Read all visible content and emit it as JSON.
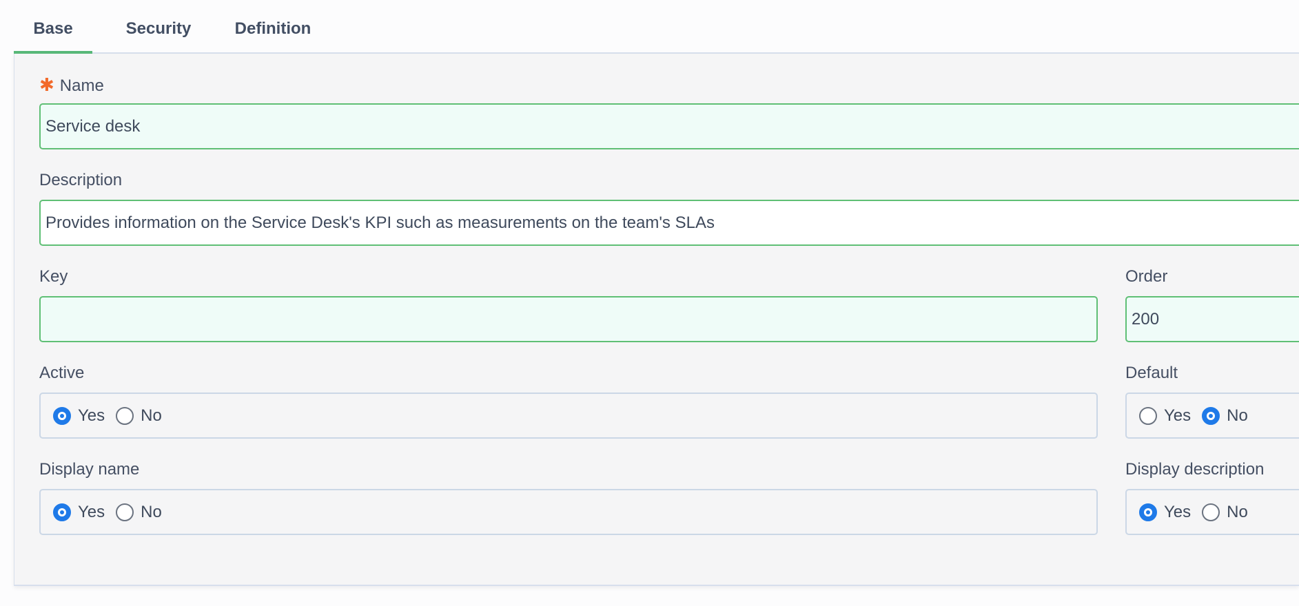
{
  "tabs": [
    {
      "label": "Base",
      "active": true
    },
    {
      "label": "Security",
      "active": false
    },
    {
      "label": "Definition",
      "active": false
    }
  ],
  "form": {
    "name": {
      "label": "Name",
      "required": true,
      "value": "Service desk"
    },
    "description": {
      "label": "Description",
      "value": "Provides information on the Service Desk's KPI such as measurements on the team's SLAs"
    },
    "key": {
      "label": "Key",
      "value": ""
    },
    "order": {
      "label": "Order",
      "value": "200"
    },
    "active": {
      "label": "Active",
      "yes": "Yes",
      "no": "No",
      "selected": "Yes"
    },
    "default": {
      "label": "Default",
      "yes": "Yes",
      "no": "No",
      "selected": "No"
    },
    "display_name": {
      "label": "Display name",
      "yes": "Yes",
      "no": "No",
      "selected": "Yes"
    },
    "display_description": {
      "label": "Display description",
      "yes": "Yes",
      "no": "No",
      "selected": "Yes"
    }
  },
  "colors": {
    "accent": "#58b878",
    "required": "#f26a2b",
    "radio_checked": "#1f7ae8"
  }
}
